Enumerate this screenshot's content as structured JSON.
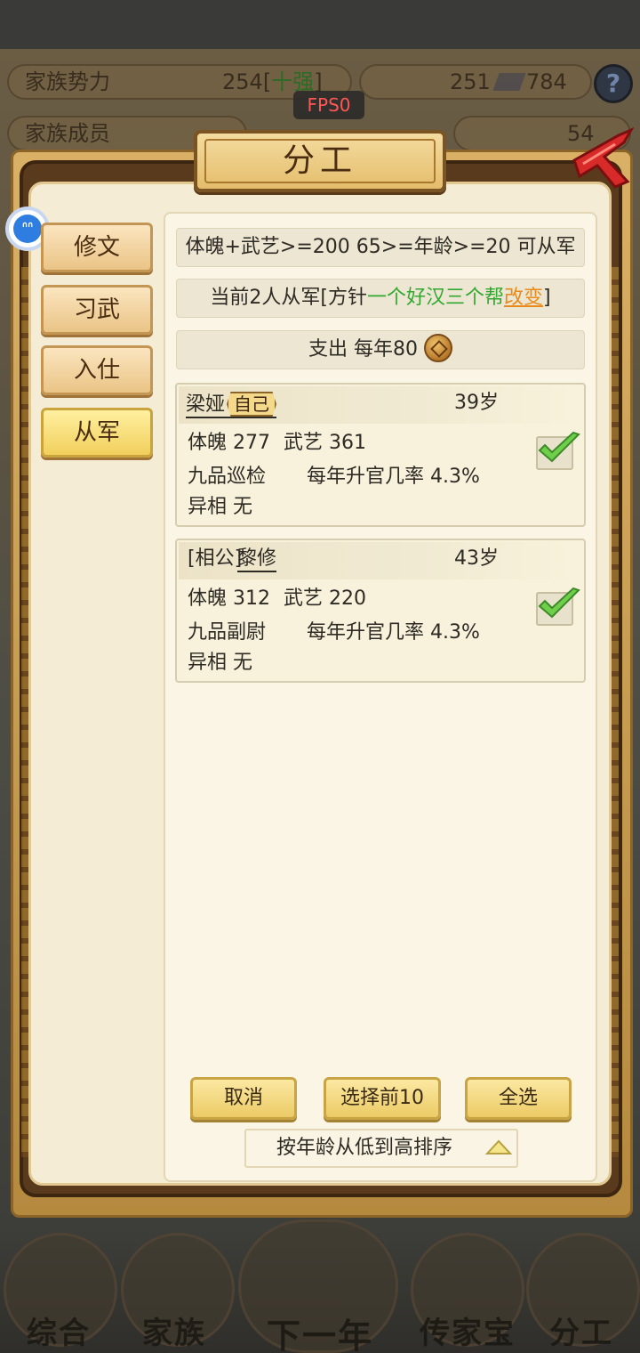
{
  "background": {
    "stat_family_power_label": "家族势力",
    "stat_family_power_value": "254",
    "stat_family_power_rank_open": "[",
    "stat_family_power_rank": "十强",
    "stat_family_power_rank_close": "]",
    "stat_silver": "251",
    "stat_coins": "784",
    "stat_members_label": "家族成员",
    "stat_gold": "54",
    "nav": [
      "综合",
      "家族",
      "下一年",
      "传家宝",
      "分工"
    ]
  },
  "fps": "FPS0",
  "panel": {
    "title": "分工",
    "tabs": [
      {
        "label": "修文",
        "active": false
      },
      {
        "label": "习武",
        "active": false
      },
      {
        "label": "入仕",
        "active": false
      },
      {
        "label": "从军",
        "active": true
      }
    ],
    "requirement": "体魄+武艺>=200 65>=年龄>=20 可从军",
    "policy": {
      "prefix": "当前2人从军[方针",
      "policy_name": "一个好汉三个帮",
      "change_link": "改变",
      "suffix": "]"
    },
    "expense": {
      "label": "支出 每年80",
      "icon": "copper-coin-icon"
    },
    "members": [
      {
        "name": "梁娅",
        "tag": "自己",
        "age": "39岁",
        "physique": "体魄 277",
        "martial": "武艺 361",
        "rank": "九品巡检",
        "promotion": "每年升官几率 4.3%",
        "trait": "异相 无",
        "checked": true
      },
      {
        "name_prefix": "[相公]",
        "name": "黎修",
        "age": "43岁",
        "physique": "体魄 312",
        "martial": "武艺 220",
        "rank": "九品副尉",
        "promotion": "每年升官几率 4.3%",
        "trait": "异相 无",
        "checked": true
      }
    ],
    "buttons": {
      "cancel": "取消",
      "select_top10": "选择前10",
      "select_all": "全选"
    },
    "sort_label": "按年龄从低到高排序"
  },
  "colors": {
    "stat_red": "#e03a2a",
    "policy_green": "#32a832",
    "link_orange": "#e88b1a",
    "fps_red": "#ff5656"
  }
}
